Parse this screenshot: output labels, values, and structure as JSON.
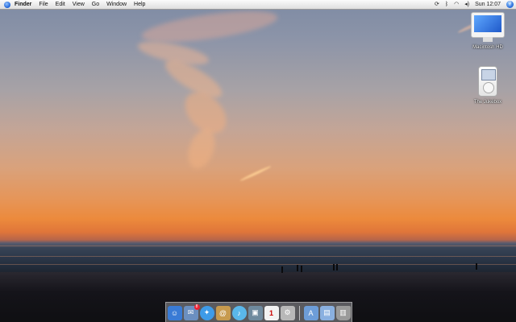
{
  "menubar": {
    "apple_icon": "apple-icon",
    "app_name": "Finder",
    "items": [
      "File",
      "Edit",
      "View",
      "Go",
      "Window",
      "Help"
    ],
    "tray_icons": [
      "sync-icon",
      "bluetooth-icon",
      "wifi-icon",
      "volume-icon"
    ],
    "clock": "Sun 12:07",
    "spotlight_icon": "spotlight-icon"
  },
  "desktop_icons": [
    {
      "label": "Macintosh HD",
      "icon": "hard-drive-icon"
    },
    {
      "label": "The Jukebox",
      "icon": "ipod-icon"
    }
  ],
  "dock": {
    "items": [
      {
        "name": "finder",
        "icon": "finder-icon",
        "color": "#3a7bd5"
      },
      {
        "name": "mail",
        "icon": "mail-icon",
        "color": "#6b8fc0",
        "badge": "8"
      },
      {
        "name": "safari",
        "icon": "safari-icon",
        "color": "#3e9be8"
      },
      {
        "name": "address-book",
        "icon": "address-book-icon",
        "color": "#c79a4e"
      },
      {
        "name": "itunes",
        "icon": "itunes-icon",
        "color": "#5ab7ea"
      },
      {
        "name": "iphoto",
        "icon": "iphoto-icon",
        "color": "#6f8a9e"
      },
      {
        "name": "ical",
        "icon": "calendar-icon",
        "color": "#f2f2f2",
        "date": "1"
      },
      {
        "name": "system-preferences",
        "icon": "apple-prefs-icon",
        "color": "#b8b8b8"
      }
    ],
    "right_items": [
      {
        "name": "applications-folder",
        "icon": "applications-folder-icon",
        "color": "#6d9dd8"
      },
      {
        "name": "documents-folder",
        "icon": "documents-folder-icon",
        "color": "#8ab0e0"
      },
      {
        "name": "trash",
        "icon": "trash-icon",
        "color": "#9a9a9a"
      }
    ]
  }
}
